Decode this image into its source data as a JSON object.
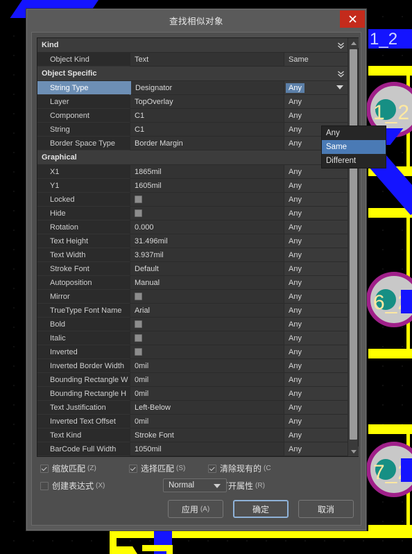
{
  "window": {
    "title": "查找相似对象",
    "close_icon": "close-icon"
  },
  "grid": {
    "sections": [
      {
        "title": "Kind",
        "chevron_icon": "chevron-double-down-icon",
        "rows": [
          {
            "name": "Object Kind",
            "value": "Text",
            "value_type": "text",
            "match": "Same"
          }
        ]
      },
      {
        "title": "Object Specific",
        "chevron_icon": "chevron-double-down-icon",
        "rows": [
          {
            "name": "String Type",
            "value": "Designator",
            "value_type": "text",
            "match": "Any",
            "selected": true,
            "dropdown_open": true
          },
          {
            "name": "Layer",
            "value": "TopOverlay",
            "value_type": "text",
            "match": "Any"
          },
          {
            "name": "Component",
            "value": "C1",
            "value_type": "text",
            "match": "Any"
          },
          {
            "name": "String",
            "value": "C1",
            "value_type": "text",
            "match": "Any"
          },
          {
            "name": "Border Space Type",
            "value": "Border Margin",
            "value_type": "text",
            "match": "Any"
          }
        ]
      },
      {
        "title": "Graphical",
        "chevron_icon": "chevron-double-down-icon",
        "rows": [
          {
            "name": "X1",
            "value": "1865mil",
            "value_type": "text",
            "match": "Any"
          },
          {
            "name": "Y1",
            "value": "1605mil",
            "value_type": "text",
            "match": "Any"
          },
          {
            "name": "Locked",
            "value": "",
            "value_type": "checkbox",
            "match": "Any"
          },
          {
            "name": "Hide",
            "value": "",
            "value_type": "checkbox",
            "match": "Any"
          },
          {
            "name": "Rotation",
            "value": "0.000",
            "value_type": "text",
            "match": "Any"
          },
          {
            "name": "Text Height",
            "value": "31.496mil",
            "value_type": "text",
            "match": "Any"
          },
          {
            "name": "Text Width",
            "value": "3.937mil",
            "value_type": "text",
            "match": "Any"
          },
          {
            "name": "Stroke Font",
            "value": "Default",
            "value_type": "text",
            "match": "Any"
          },
          {
            "name": "Autoposition",
            "value": "Manual",
            "value_type": "text",
            "match": "Any"
          },
          {
            "name": "Mirror",
            "value": "",
            "value_type": "checkbox",
            "match": "Any"
          },
          {
            "name": "TrueType Font Name",
            "value": "Arial",
            "value_type": "text",
            "match": "Any"
          },
          {
            "name": "Bold",
            "value": "",
            "value_type": "checkbox",
            "match": "Any"
          },
          {
            "name": "Italic",
            "value": "",
            "value_type": "checkbox",
            "match": "Any"
          },
          {
            "name": "Inverted",
            "value": "",
            "value_type": "checkbox",
            "match": "Any"
          },
          {
            "name": "Inverted Border Width",
            "value": "0mil",
            "value_type": "text",
            "match": "Any"
          },
          {
            "name": "Bounding Rectangle W",
            "value": "0mil",
            "value_type": "text",
            "match": "Any"
          },
          {
            "name": "Bounding Rectangle H",
            "value": "0mil",
            "value_type": "text",
            "match": "Any"
          },
          {
            "name": "Text Justification",
            "value": "Left-Below",
            "value_type": "text",
            "match": "Any"
          },
          {
            "name": "Inverted Text Offset",
            "value": "0mil",
            "value_type": "text",
            "match": "Any"
          },
          {
            "name": "Text Kind",
            "value": "Stroke Font",
            "value_type": "text",
            "match": "Any"
          },
          {
            "name": "BarCode Full Width",
            "value": "1050mil",
            "value_type": "text",
            "match": "Any"
          }
        ]
      }
    ],
    "dropdown": {
      "current": "Any",
      "options": [
        "Any",
        "Same",
        "Different"
      ],
      "selected": "Same"
    },
    "scrollbar": {
      "up_icon": "scroll-up-arrow-icon",
      "down_icon": "scroll-down-arrow-icon"
    }
  },
  "options": {
    "zoom_match": {
      "label": "缩放匹配",
      "accel": "(Z)",
      "checked": true
    },
    "select_match": {
      "label": "选择匹配",
      "accel": "(S)",
      "checked": true
    },
    "clear_existing": {
      "label": "清除现有的",
      "accel": "(C",
      "checked": true
    },
    "create_expression": {
      "label": "创建表达式",
      "accel": "(X)",
      "checked": false
    },
    "open_properties": {
      "label": "打开属性",
      "accel": "(R)",
      "checked": true
    },
    "mode_select": {
      "value": "Normal",
      "arrow_icon": "chevron-down-icon"
    }
  },
  "buttons": {
    "apply": {
      "label": "应用",
      "accel": "(A)"
    },
    "ok": {
      "label": "确定",
      "accel": ""
    },
    "cancel": {
      "label": "取消",
      "accel": ""
    }
  },
  "pcb": {
    "net_labels": [
      "1_2"
    ],
    "pad_labels": [
      "1_2",
      "6_2",
      "7_2"
    ],
    "colors": {
      "top_layer_yellow": "#ffff00",
      "trace_blue": "#1414ff",
      "pad_ring": "#a0208a",
      "pad_body": "#c8c8c8",
      "hole": "#168f84",
      "silkscreen_text": "#ffe9a0",
      "background": "#000000"
    }
  }
}
